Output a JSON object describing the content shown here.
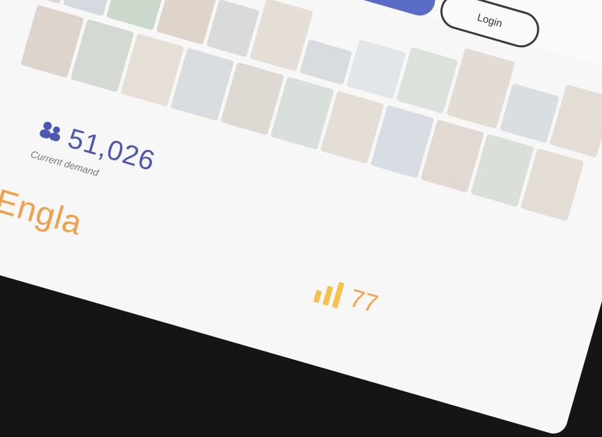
{
  "auth": {
    "login_label": "Login"
  },
  "stat": {
    "value": "51,026",
    "caption": "Current demand"
  },
  "region": {
    "label": "SE Engla"
  },
  "bars": {
    "value": "77"
  },
  "colors": {
    "accent": "#5b6cc7",
    "orange": "#f0a04a",
    "yellow": "#f2c24d"
  }
}
